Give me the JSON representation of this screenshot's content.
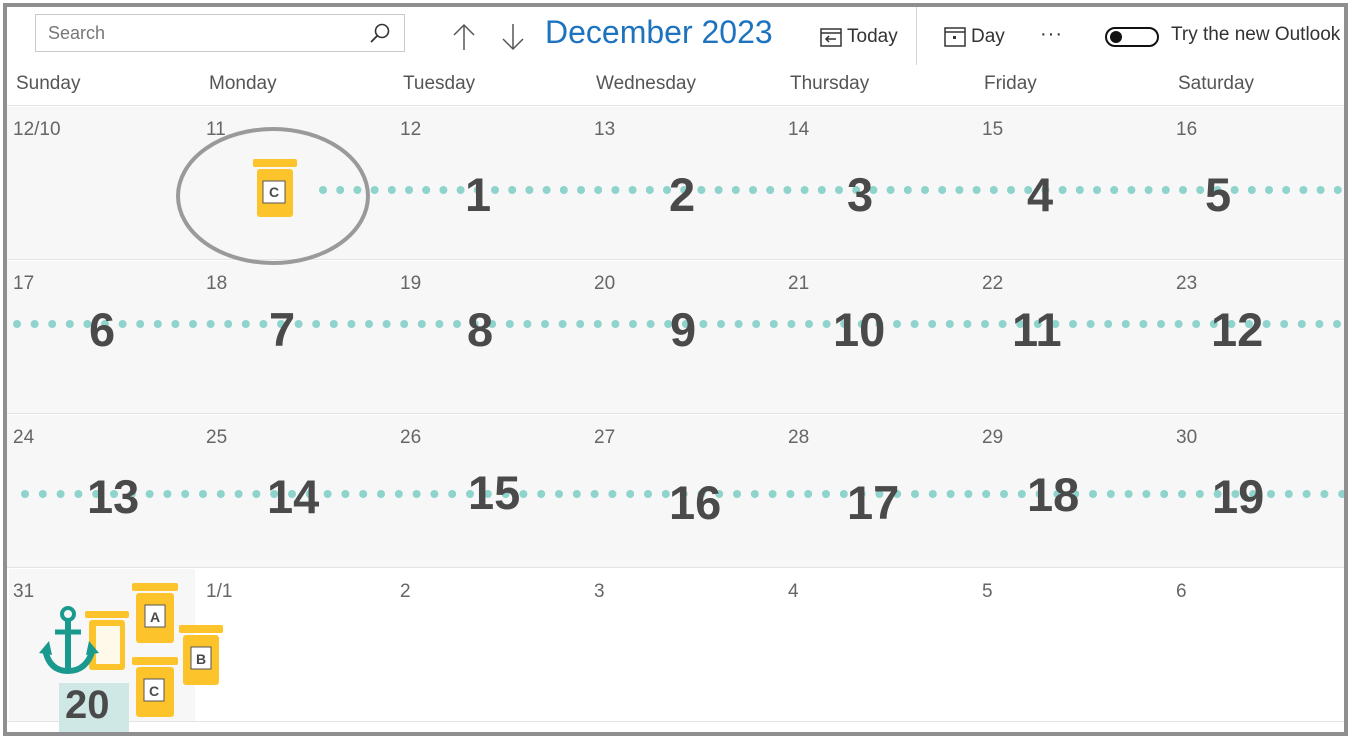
{
  "toolbar": {
    "search_placeholder": "Search",
    "month_title": "December 2023",
    "today_label": "Today",
    "day_label": "Day",
    "more_label": "···",
    "new_outlook_label": "Try the new Outlook",
    "new_outlook_on": false
  },
  "weekdays": [
    "Sunday",
    "Monday",
    "Tuesday",
    "Wednesday",
    "Thursday",
    "Friday",
    "Saturday"
  ],
  "weeks": [
    [
      "12/10",
      "11",
      "12",
      "13",
      "14",
      "15",
      "16"
    ],
    [
      "17",
      "18",
      "19",
      "20",
      "21",
      "22",
      "23"
    ],
    [
      "24",
      "25",
      "26",
      "27",
      "28",
      "29",
      "30"
    ],
    [
      "31",
      "1/1",
      "2",
      "3",
      "4",
      "5",
      "6"
    ]
  ],
  "step_numbers": [
    [
      "1",
      "2",
      "3",
      "4",
      "5"
    ],
    [
      "6",
      "7",
      "8",
      "9",
      "10",
      "11",
      "12"
    ],
    [
      "13",
      "14",
      "15",
      "16",
      "17",
      "18",
      "19"
    ]
  ],
  "final_step": "20",
  "jar_labels": {
    "start": "C",
    "stack": [
      "A",
      "B",
      "C"
    ]
  },
  "colors": {
    "accent_blue": "#1e73be",
    "dot_teal": "#8fd3cd",
    "jar_yellow": "#fcc42a",
    "anchor_teal": "#1a9a8e",
    "circle_gray": "#9a9a9a",
    "final_badge": "#cfe7e5"
  },
  "icons": {
    "search": "search-icon",
    "up": "arrow-up-icon",
    "down": "arrow-down-icon",
    "today": "calendar-today-icon",
    "day": "calendar-day-icon",
    "more": "more-icon",
    "anchor": "anchor-icon",
    "jar": "medicine-jar-icon"
  }
}
